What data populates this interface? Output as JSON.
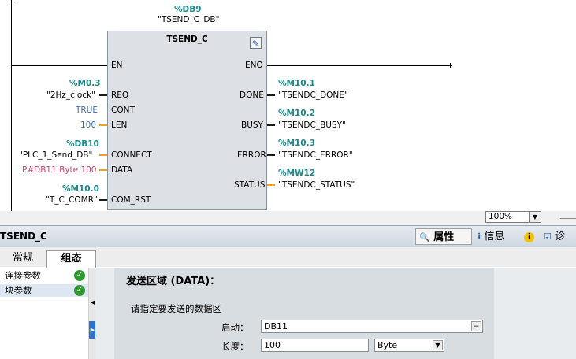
{
  "ladder": {
    "instance_db_addr": "%DB9",
    "instance_db_name": "\"TSEND_C_DB\"",
    "block_name": "TSEND_C",
    "inputs": {
      "en": "EN",
      "req": {
        "pin": "REQ",
        "addr": "%M0.3",
        "tag": "\"2Hz_clock\""
      },
      "cont": {
        "pin": "CONT",
        "value": "TRUE"
      },
      "len": {
        "pin": "LEN",
        "value": "100"
      },
      "connect": {
        "pin": "CONNECT",
        "addr": "%DB10",
        "tag": "\"PLC_1_Send_DB\""
      },
      "data": {
        "pin": "DATA",
        "value": "P#DB11 Byte 100"
      },
      "com_rst": {
        "pin": "COM_RST",
        "addr": "%M10.0",
        "tag": "\"T_C_COMR\""
      }
    },
    "outputs": {
      "eno": "ENO",
      "done": {
        "pin": "DONE",
        "addr": "%M10.1",
        "tag": "\"TSENDC_DONE\""
      },
      "busy": {
        "pin": "BUSY",
        "addr": "%M10.2",
        "tag": "\"TSENDC_BUSY\""
      },
      "error": {
        "pin": "ERROR",
        "addr": "%M10.3",
        "tag": "\"TSENDC_ERROR\""
      },
      "status": {
        "pin": "STATUS",
        "addr": "%MW12",
        "tag": "\"TSENDC_STATUS\""
      }
    }
  },
  "zoom": {
    "value": "100%"
  },
  "inspector": {
    "title": "TSEND_C",
    "tabs": {
      "properties": "属性",
      "info": "信息",
      "diagnostics": "诊断"
    },
    "subtabs": {
      "general": "常规",
      "config": "组态"
    },
    "nav": [
      {
        "label": "连接参数"
      },
      {
        "label": "块参数"
      }
    ],
    "section_title": "发送区域 (DATA)：",
    "hint": "请指定要发送的数据区",
    "start": {
      "label": "启动：",
      "value": "DB11"
    },
    "length": {
      "label": "长度：",
      "value": "100",
      "unit": "Byte"
    }
  },
  "colors": {
    "address": "#1b8a8a",
    "constant": "#3d6fb6",
    "pointer": "#c4436a",
    "ok": "#2f9a2f",
    "wire_orange": "#f0a020"
  }
}
